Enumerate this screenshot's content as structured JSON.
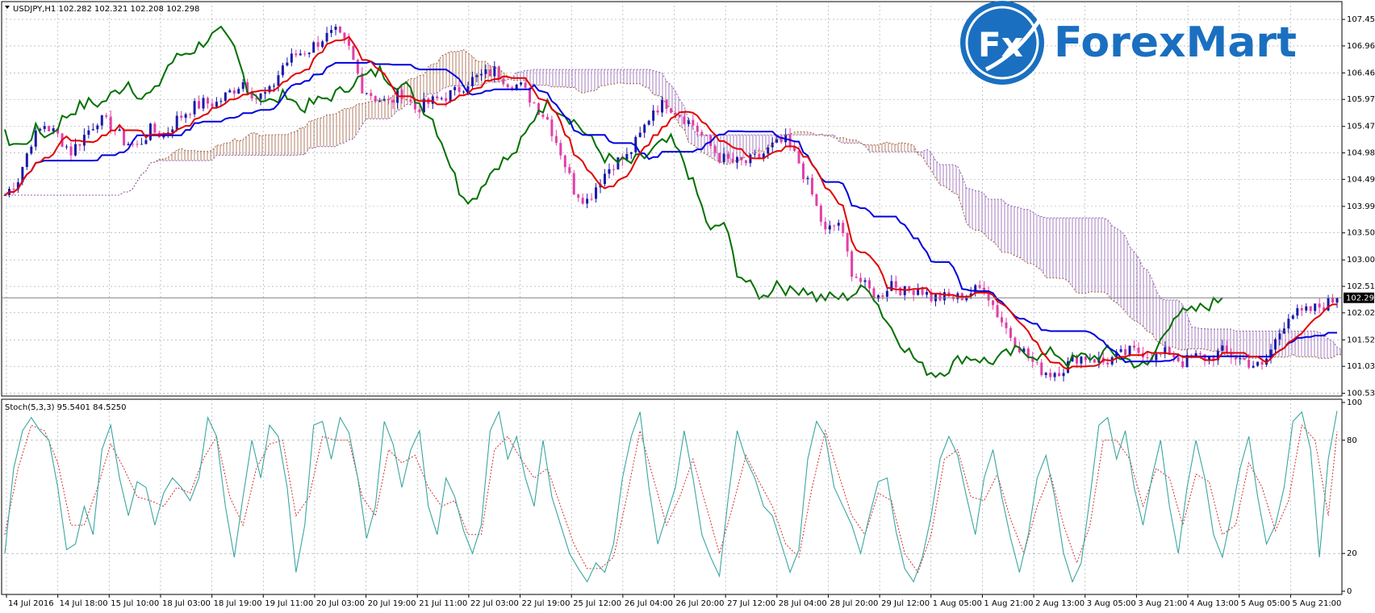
{
  "header": {
    "main_title": "USDJPY,H1  102.282 102.321 102.208 102.298",
    "stoch_title": "Stoch(5,3,3) 95.5401 84.5250"
  },
  "logo": {
    "badge": "Fx",
    "text": "ForexMart"
  },
  "colors": {
    "bull": "#1a1aa8",
    "bear": "#e040a8",
    "tenkan": "#e00000",
    "kijun": "#0000dd",
    "chikou": "#007000",
    "span_a": "#a06040",
    "span_b": "#9060b0",
    "stoch_main": "#3aa6a0",
    "stoch_signal": "#d03030",
    "grid": "#9aa0a6"
  },
  "chart_data": [
    {
      "type": "candlestick",
      "symbol": "USDJPY",
      "timeframe": "H1",
      "ohlc_last": {
        "open": 102.282,
        "high": 102.321,
        "low": 102.208,
        "close": 102.298
      },
      "current_price_label": "102.298",
      "yaxis_ticks": [
        "107.450",
        "106.960",
        "106.460",
        "105.970",
        "105.470",
        "104.980",
        "104.490",
        "103.990",
        "103.500",
        "103.000",
        "102.510",
        "102.020",
        "101.520",
        "101.030",
        "100.530"
      ],
      "ylim": [
        100.48,
        107.78
      ],
      "x_tick_labels": [
        "14 Jul 2016",
        "14 Jul 18:00",
        "15 Jul 10:00",
        "18 Jul 03:00",
        "18 Jul 19:00",
        "19 Jul 11:00",
        "20 Jul 03:00",
        "20 Jul 19:00",
        "21 Jul 11:00",
        "22 Jul 03:00",
        "22 Jul 19:00",
        "25 Jul 12:00",
        "26 Jul 04:00",
        "26 Jul 20:00",
        "27 Jul 12:00",
        "28 Jul 04:00",
        "28 Jul 20:00",
        "29 Jul 12:00",
        "1 Aug 05:00",
        "1 Aug 21:00",
        "2 Aug 13:00",
        "3 Aug 05:00",
        "3 Aug 21:00",
        "4 Aug 13:00",
        "5 Aug 05:00",
        "5 Aug 21:00"
      ],
      "close_path": [
        [
          0,
          104.2
        ],
        [
          3,
          104.5
        ],
        [
          6,
          105.2
        ],
        [
          9,
          105.5
        ],
        [
          12,
          105.3
        ],
        [
          15,
          105.0
        ],
        [
          18,
          105.3
        ],
        [
          21,
          105.6
        ],
        [
          24,
          105.5
        ],
        [
          27,
          105.2
        ],
        [
          30,
          105.1
        ],
        [
          33,
          105.4
        ],
        [
          36,
          105.3
        ],
        [
          39,
          105.6
        ],
        [
          42,
          105.8
        ],
        [
          45,
          105.9
        ],
        [
          48,
          105.9
        ],
        [
          51,
          106.1
        ],
        [
          54,
          106.3
        ],
        [
          57,
          106.0
        ],
        [
          60,
          106.1
        ],
        [
          63,
          106.6
        ],
        [
          66,
          106.8
        ],
        [
          69,
          106.9
        ],
        [
          72,
          107.1
        ],
        [
          75,
          107.2
        ],
        [
          78,
          106.9
        ],
        [
          81,
          106.2
        ],
        [
          84,
          106.0
        ],
        [
          87,
          105.9
        ],
        [
          90,
          106.1
        ],
        [
          93,
          105.8
        ],
        [
          96,
          105.9
        ],
        [
          99,
          106.0
        ],
        [
          102,
          106.1
        ],
        [
          105,
          106.3
        ],
        [
          108,
          106.4
        ],
        [
          111,
          106.5
        ],
        [
          114,
          106.3
        ],
        [
          117,
          106.2
        ],
        [
          120,
          105.9
        ],
        [
          123,
          105.6
        ],
        [
          126,
          105.0
        ],
        [
          129,
          104.3
        ],
        [
          132,
          104.1
        ],
        [
          135,
          104.5
        ],
        [
          138,
          104.8
        ],
        [
          141,
          104.9
        ],
        [
          144,
          105.3
        ],
        [
          147,
          105.8
        ],
        [
          150,
          105.9
        ],
        [
          153,
          105.7
        ],
        [
          156,
          105.5
        ],
        [
          159,
          105.2
        ],
        [
          162,
          104.9
        ],
        [
          165,
          104.8
        ],
        [
          168,
          104.8
        ],
        [
          171,
          104.9
        ],
        [
          174,
          105.1
        ],
        [
          177,
          105.2
        ],
        [
          180,
          104.8
        ],
        [
          183,
          104.2
        ],
        [
          186,
          103.5
        ],
        [
          189,
          103.7
        ],
        [
          192,
          102.8
        ],
        [
          195,
          102.5
        ],
        [
          198,
          102.3
        ],
        [
          201,
          102.6
        ],
        [
          204,
          102.4
        ],
        [
          207,
          102.5
        ],
        [
          210,
          102.3
        ],
        [
          213,
          102.3
        ],
        [
          216,
          102.3
        ],
        [
          219,
          102.4
        ],
        [
          222,
          102.5
        ],
        [
          225,
          102.0
        ],
        [
          228,
          101.6
        ],
        [
          231,
          101.3
        ],
        [
          234,
          101.0
        ],
        [
          237,
          100.9
        ],
        [
          240,
          101.0
        ],
        [
          243,
          101.2
        ],
        [
          246,
          101.2
        ],
        [
          249,
          101.1
        ],
        [
          252,
          101.2
        ],
        [
          255,
          101.3
        ],
        [
          258,
          101.3
        ],
        [
          261,
          101.2
        ],
        [
          264,
          101.3
        ],
        [
          267,
          101.1
        ],
        [
          270,
          101.2
        ],
        [
          273,
          101.2
        ],
        [
          276,
          101.3
        ],
        [
          279,
          101.2
        ],
        [
          282,
          101.1
        ],
        [
          285,
          101.0
        ],
        [
          288,
          101.5
        ],
        [
          291,
          102.0
        ],
        [
          294,
          102.0
        ],
        [
          297,
          102.1
        ],
        [
          300,
          102.2
        ],
        [
          302,
          102.298
        ]
      ]
    },
    {
      "type": "line",
      "title": "Stoch(5,3,3) 95.5401 84.5250",
      "yaxis_ticks": [
        "100",
        "80",
        "20",
        "0"
      ],
      "ylim": [
        0,
        100
      ],
      "levels": [
        20,
        80
      ],
      "main_value": 95.5401,
      "signal_value": 84.525,
      "main_path": [
        [
          0,
          20
        ],
        [
          2,
          65
        ],
        [
          4,
          85
        ],
        [
          6,
          92
        ],
        [
          8,
          85
        ],
        [
          10,
          80
        ],
        [
          12,
          55
        ],
        [
          14,
          22
        ],
        [
          16,
          25
        ],
        [
          18,
          45
        ],
        [
          20,
          30
        ],
        [
          22,
          75
        ],
        [
          24,
          88
        ],
        [
          26,
          60
        ],
        [
          28,
          40
        ],
        [
          30,
          58
        ],
        [
          32,
          55
        ],
        [
          34,
          35
        ],
        [
          36,
          52
        ],
        [
          38,
          60
        ],
        [
          40,
          55
        ],
        [
          42,
          48
        ],
        [
          44,
          60
        ],
        [
          46,
          92
        ],
        [
          48,
          82
        ],
        [
          50,
          45
        ],
        [
          52,
          18
        ],
        [
          54,
          50
        ],
        [
          56,
          80
        ],
        [
          58,
          60
        ],
        [
          60,
          88
        ],
        [
          62,
          82
        ],
        [
          64,
          55
        ],
        [
          66,
          10
        ],
        [
          68,
          35
        ],
        [
          70,
          88
        ],
        [
          72,
          90
        ],
        [
          74,
          70
        ],
        [
          76,
          92
        ],
        [
          78,
          84
        ],
        [
          80,
          60
        ],
        [
          82,
          28
        ],
        [
          84,
          45
        ],
        [
          86,
          90
        ],
        [
          88,
          78
        ],
        [
          90,
          55
        ],
        [
          92,
          75
        ],
        [
          94,
          85
        ],
        [
          96,
          45
        ],
        [
          98,
          30
        ],
        [
          100,
          60
        ],
        [
          102,
          50
        ],
        [
          104,
          32
        ],
        [
          106,
          20
        ],
        [
          108,
          35
        ],
        [
          110,
          85
        ],
        [
          112,
          95
        ],
        [
          114,
          70
        ],
        [
          116,
          82
        ],
        [
          118,
          60
        ],
        [
          120,
          45
        ],
        [
          122,
          80
        ],
        [
          124,
          50
        ],
        [
          126,
          35
        ],
        [
          128,
          20
        ],
        [
          130,
          12
        ],
        [
          132,
          5
        ],
        [
          134,
          15
        ],
        [
          136,
          10
        ],
        [
          138,
          25
        ],
        [
          140,
          60
        ],
        [
          142,
          82
        ],
        [
          144,
          95
        ],
        [
          146,
          55
        ],
        [
          148,
          25
        ],
        [
          150,
          40
        ],
        [
          152,
          55
        ],
        [
          154,
          85
        ],
        [
          156,
          60
        ],
        [
          158,
          30
        ],
        [
          160,
          18
        ],
        [
          162,
          8
        ],
        [
          164,
          50
        ],
        [
          166,
          85
        ],
        [
          168,
          70
        ],
        [
          170,
          60
        ],
        [
          172,
          45
        ],
        [
          174,
          40
        ],
        [
          176,
          25
        ],
        [
          178,
          10
        ],
        [
          180,
          22
        ],
        [
          182,
          70
        ],
        [
          184,
          90
        ],
        [
          186,
          82
        ],
        [
          188,
          55
        ],
        [
          190,
          45
        ],
        [
          192,
          35
        ],
        [
          194,
          20
        ],
        [
          196,
          40
        ],
        [
          198,
          58
        ],
        [
          200,
          60
        ],
        [
          202,
          32
        ],
        [
          204,
          12
        ],
        [
          206,
          5
        ],
        [
          208,
          18
        ],
        [
          210,
          40
        ],
        [
          212,
          70
        ],
        [
          214,
          82
        ],
        [
          216,
          72
        ],
        [
          218,
          50
        ],
        [
          220,
          30
        ],
        [
          222,
          60
        ],
        [
          224,
          75
        ],
        [
          226,
          50
        ],
        [
          228,
          28
        ],
        [
          230,
          10
        ],
        [
          232,
          30
        ],
        [
          234,
          60
        ],
        [
          236,
          72
        ],
        [
          238,
          50
        ],
        [
          240,
          20
        ],
        [
          242,
          5
        ],
        [
          244,
          15
        ],
        [
          246,
          50
        ],
        [
          248,
          88
        ],
        [
          250,
          92
        ],
        [
          252,
          70
        ],
        [
          254,
          85
        ],
        [
          256,
          55
        ],
        [
          258,
          35
        ],
        [
          260,
          60
        ],
        [
          262,
          80
        ],
        [
          264,
          45
        ],
        [
          266,
          20
        ],
        [
          268,
          55
        ],
        [
          270,
          80
        ],
        [
          272,
          60
        ],
        [
          274,
          30
        ],
        [
          276,
          18
        ],
        [
          278,
          40
        ],
        [
          280,
          65
        ],
        [
          282,
          82
        ],
        [
          284,
          50
        ],
        [
          286,
          25
        ],
        [
          288,
          35
        ],
        [
          290,
          55
        ],
        [
          292,
          90
        ],
        [
          294,
          95
        ],
        [
          296,
          75
        ],
        [
          298,
          18
        ],
        [
          300,
          70
        ],
        [
          302,
          95.54
        ]
      ],
      "signal_path": [
        [
          0,
          30
        ],
        [
          3,
          65
        ],
        [
          6,
          88
        ],
        [
          9,
          85
        ],
        [
          12,
          68
        ],
        [
          15,
          35
        ],
        [
          18,
          35
        ],
        [
          21,
          55
        ],
        [
          24,
          78
        ],
        [
          27,
          65
        ],
        [
          30,
          50
        ],
        [
          33,
          48
        ],
        [
          36,
          45
        ],
        [
          39,
          55
        ],
        [
          42,
          52
        ],
        [
          45,
          70
        ],
        [
          48,
          82
        ],
        [
          51,
          50
        ],
        [
          54,
          35
        ],
        [
          57,
          65
        ],
        [
          60,
          78
        ],
        [
          63,
          80
        ],
        [
          66,
          40
        ],
        [
          69,
          50
        ],
        [
          72,
          82
        ],
        [
          75,
          80
        ],
        [
          78,
          80
        ],
        [
          81,
          50
        ],
        [
          84,
          40
        ],
        [
          87,
          75
        ],
        [
          90,
          68
        ],
        [
          93,
          72
        ],
        [
          96,
          55
        ],
        [
          99,
          45
        ],
        [
          102,
          48
        ],
        [
          105,
          30
        ],
        [
          108,
          30
        ],
        [
          111,
          75
        ],
        [
          114,
          82
        ],
        [
          117,
          70
        ],
        [
          120,
          60
        ],
        [
          123,
          65
        ],
        [
          126,
          45
        ],
        [
          129,
          25
        ],
        [
          132,
          12
        ],
        [
          135,
          12
        ],
        [
          138,
          18
        ],
        [
          141,
          50
        ],
        [
          144,
          85
        ],
        [
          147,
          60
        ],
        [
          150,
          35
        ],
        [
          153,
          50
        ],
        [
          156,
          70
        ],
        [
          159,
          45
        ],
        [
          162,
          20
        ],
        [
          165,
          45
        ],
        [
          168,
          72
        ],
        [
          171,
          58
        ],
        [
          174,
          45
        ],
        [
          177,
          25
        ],
        [
          180,
          18
        ],
        [
          183,
          55
        ],
        [
          186,
          85
        ],
        [
          189,
          62
        ],
        [
          192,
          40
        ],
        [
          195,
          30
        ],
        [
          198,
          52
        ],
        [
          201,
          48
        ],
        [
          204,
          20
        ],
        [
          207,
          10
        ],
        [
          210,
          30
        ],
        [
          213,
          70
        ],
        [
          216,
          75
        ],
        [
          219,
          50
        ],
        [
          222,
          48
        ],
        [
          225,
          62
        ],
        [
          228,
          38
        ],
        [
          231,
          20
        ],
        [
          234,
          45
        ],
        [
          237,
          62
        ],
        [
          240,
          35
        ],
        [
          243,
          15
        ],
        [
          246,
          35
        ],
        [
          249,
          80
        ],
        [
          252,
          80
        ],
        [
          255,
          70
        ],
        [
          258,
          45
        ],
        [
          261,
          65
        ],
        [
          264,
          60
        ],
        [
          267,
          35
        ],
        [
          270,
          62
        ],
        [
          273,
          58
        ],
        [
          276,
          30
        ],
        [
          279,
          35
        ],
        [
          282,
          68
        ],
        [
          285,
          55
        ],
        [
          288,
          32
        ],
        [
          291,
          48
        ],
        [
          294,
          88
        ],
        [
          297,
          80
        ],
        [
          300,
          40
        ],
        [
          302,
          84.53
        ]
      ]
    }
  ]
}
